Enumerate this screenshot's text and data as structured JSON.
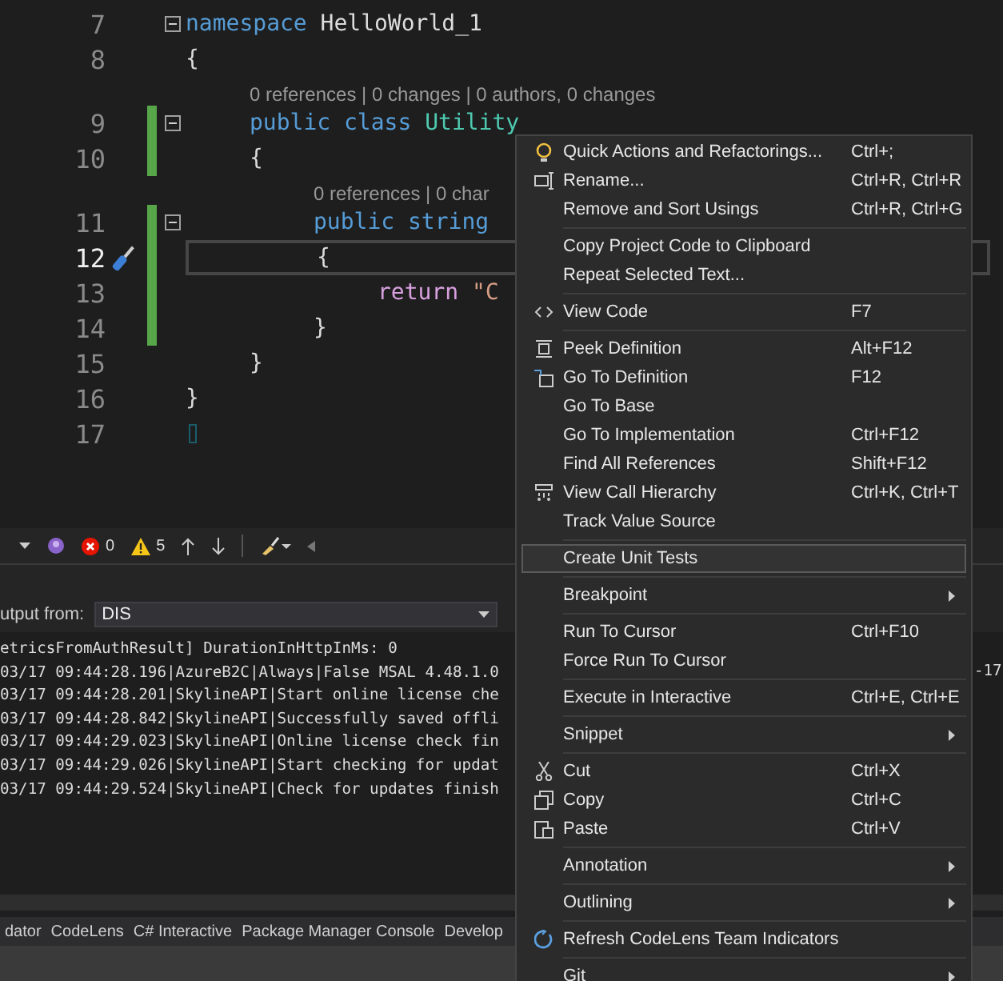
{
  "editor": {
    "lines": [
      {
        "kind": "code",
        "number": "7",
        "fold": true,
        "changed": false,
        "current": false,
        "tokens": [
          {
            "text": "namespace",
            "kind": "keyword"
          },
          {
            "text": " HelloWorld_1",
            "kind": "plain"
          }
        ]
      },
      {
        "kind": "code",
        "number": "8",
        "fold": false,
        "changed": false,
        "current": false,
        "tokens": [
          {
            "text": "{",
            "kind": "plain"
          }
        ]
      },
      {
        "kind": "codelens",
        "text": "\t0 references | 0 changes | 0 authors, 0 changes"
      },
      {
        "kind": "code",
        "number": "9",
        "fold": true,
        "changed": true,
        "current": false,
        "tokens": [
          {
            "text": "\tpublic class",
            "kind": "keyword"
          },
          {
            "text": " Utility",
            "kind": "type"
          }
        ]
      },
      {
        "kind": "code",
        "number": "10",
        "fold": false,
        "changed": true,
        "current": false,
        "tokens": [
          {
            "text": "\t{",
            "kind": "plain"
          }
        ]
      },
      {
        "kind": "codelens",
        "text": "\t\t0 references | 0 char"
      },
      {
        "kind": "code",
        "number": "11",
        "fold": true,
        "changed": true,
        "current": false,
        "tokens": [
          {
            "text": "\t\tpublic string",
            "kind": "keyword"
          }
        ]
      },
      {
        "kind": "code",
        "number": "12",
        "fold": false,
        "changed": true,
        "current": true,
        "tokens": [
          {
            "text": "\t\t{",
            "kind": "plain"
          }
        ]
      },
      {
        "kind": "code",
        "number": "13",
        "fold": false,
        "changed": true,
        "current": false,
        "tokens": [
          {
            "text": "\t\t\treturn",
            "kind": "control"
          },
          {
            "text": " \"C",
            "kind": "string"
          }
        ]
      },
      {
        "kind": "code",
        "number": "14",
        "fold": false,
        "changed": true,
        "current": false,
        "tokens": [
          {
            "text": "\t\t}",
            "kind": "plain"
          }
        ]
      },
      {
        "kind": "code",
        "number": "15",
        "fold": false,
        "changed": false,
        "current": false,
        "tokens": [
          {
            "text": "\t}",
            "kind": "plain"
          }
        ]
      },
      {
        "kind": "code",
        "number": "16",
        "fold": false,
        "changed": false,
        "current": false,
        "tokens": [
          {
            "text": "}",
            "kind": "plain"
          }
        ]
      },
      {
        "kind": "code",
        "number": "17",
        "fold": false,
        "changed": false,
        "current": false
      }
    ]
  },
  "error_list_toolbar": {
    "errors": "0",
    "warnings": "5"
  },
  "output": {
    "label": "utput from:",
    "source": "DIS",
    "lines": [
      "etricsFromAuthResult] DurationInHttpInMs: 0",
      "03/17 09:44:28.196|AzureB2C|Always|False MSAL 4.48.1.0",
      "03/17 09:44:28.201|SkylineAPI|Start online license che",
      "03/17 09:44:28.842|SkylineAPI|Successfully saved offli",
      "03/17 09:44:29.023|SkylineAPI|Online license check fin",
      "03/17 09:44:29.026|SkylineAPI|Start checking for updat",
      "03/17 09:44:29.524|SkylineAPI|Check for updates finish"
    ],
    "right_text": "-17"
  },
  "bottom_tabs": [
    "dator",
    "CodeLens",
    "C# Interactive",
    "Package Manager Console",
    "Develop"
  ],
  "context_menu": {
    "items": [
      {
        "kind": "item",
        "label": "Quick Actions and Refactorings...",
        "shortcut": "Ctrl+;",
        "selected": false,
        "submenu": false
      },
      {
        "kind": "item",
        "label": "Rename...",
        "shortcut": "Ctrl+R, Ctrl+R",
        "selected": false,
        "submenu": false
      },
      {
        "kind": "item",
        "label": "Remove and Sort Usings",
        "shortcut": "Ctrl+R, Ctrl+G",
        "selected": false,
        "submenu": false
      },
      {
        "kind": "separator"
      },
      {
        "kind": "item",
        "label": "Copy Project Code to Clipboard",
        "selected": false,
        "submenu": false
      },
      {
        "kind": "item",
        "label": "Repeat Selected Text...",
        "selected": false,
        "submenu": false
      },
      {
        "kind": "separator"
      },
      {
        "kind": "item",
        "label": "View Code",
        "shortcut": "F7",
        "selected": false,
        "submenu": false
      },
      {
        "kind": "separator"
      },
      {
        "kind": "item",
        "label": "Peek Definition",
        "shortcut": "Alt+F12",
        "selected": false,
        "submenu": false
      },
      {
        "kind": "item",
        "label": "Go To Definition",
        "shortcut": "F12",
        "selected": false,
        "submenu": false
      },
      {
        "kind": "item",
        "label": "Go To Base",
        "selected": false,
        "submenu": false
      },
      {
        "kind": "item",
        "label": "Go To Implementation",
        "shortcut": "Ctrl+F12",
        "selected": false,
        "submenu": false
      },
      {
        "kind": "item",
        "label": "Find All References",
        "shortcut": "Shift+F12",
        "selected": false,
        "submenu": false
      },
      {
        "kind": "item",
        "label": "View Call Hierarchy",
        "shortcut": "Ctrl+K, Ctrl+T",
        "selected": false,
        "submenu": false
      },
      {
        "kind": "item",
        "label": "Track Value Source",
        "selected": false,
        "submenu": false
      },
      {
        "kind": "separator"
      },
      {
        "kind": "item",
        "label": "Create Unit Tests",
        "selected": true,
        "submenu": false
      },
      {
        "kind": "separator"
      },
      {
        "kind": "item",
        "label": "Breakpoint",
        "selected": false,
        "submenu": true
      },
      {
        "kind": "separator"
      },
      {
        "kind": "item",
        "label": "Run To Cursor",
        "shortcut": "Ctrl+F10",
        "selected": false,
        "submenu": false
      },
      {
        "kind": "item",
        "label": "Force Run To Cursor",
        "selected": false,
        "submenu": false
      },
      {
        "kind": "separator"
      },
      {
        "kind": "item",
        "label": "Execute in Interactive",
        "shortcut": "Ctrl+E, Ctrl+E",
        "selected": false,
        "submenu": false
      },
      {
        "kind": "separator"
      },
      {
        "kind": "item",
        "label": "Snippet",
        "selected": false,
        "submenu": true
      },
      {
        "kind": "separator"
      },
      {
        "kind": "item",
        "label": "Cut",
        "shortcut": "Ctrl+X",
        "selected": false,
        "submenu": false
      },
      {
        "kind": "item",
        "label": "Copy",
        "shortcut": "Ctrl+C",
        "selected": false,
        "submenu": false
      },
      {
        "kind": "item",
        "label": "Paste",
        "shortcut": "Ctrl+V",
        "selected": false,
        "submenu": false
      },
      {
        "kind": "separator"
      },
      {
        "kind": "item",
        "label": "Annotation",
        "selected": false,
        "submenu": true
      },
      {
        "kind": "separator"
      },
      {
        "kind": "item",
        "label": "Outlining",
        "selected": false,
        "submenu": true
      },
      {
        "kind": "separator"
      },
      {
        "kind": "item",
        "label": "Refresh CodeLens Team Indicators",
        "selected": false,
        "submenu": false
      },
      {
        "kind": "separator"
      },
      {
        "kind": "item",
        "label": "Git",
        "selected": false,
        "submenu": true
      }
    ]
  }
}
